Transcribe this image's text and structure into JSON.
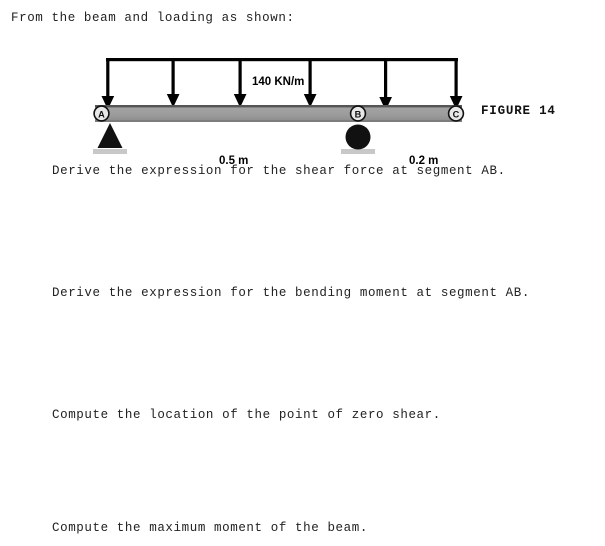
{
  "document": {
    "intro": "From the beam and loading as shown:",
    "questions": [
      "Derive the expression for the shear force at segment AB.",
      "Derive the expression for the bending moment at segment AB.",
      "Compute the location of the point of zero shear.",
      "Compute the maximum moment of the beam."
    ]
  },
  "figure": {
    "caption": "FIGURE 14",
    "load_label": "140 KN/m",
    "dimension_ab": "0.5 m",
    "dimension_bc": "0.2 m",
    "node_a": "A",
    "node_b": "B",
    "node_c": "C",
    "support_a_type": "pin-support",
    "support_b_type": "roller-support",
    "load_arrow_count": 6,
    "colors": {
      "beam_fill": "#9a9a9a",
      "beam_edge": "#4d4d4d",
      "arrow": "#000000",
      "support_plate": "#c8c8c8",
      "text": "#000000"
    }
  }
}
